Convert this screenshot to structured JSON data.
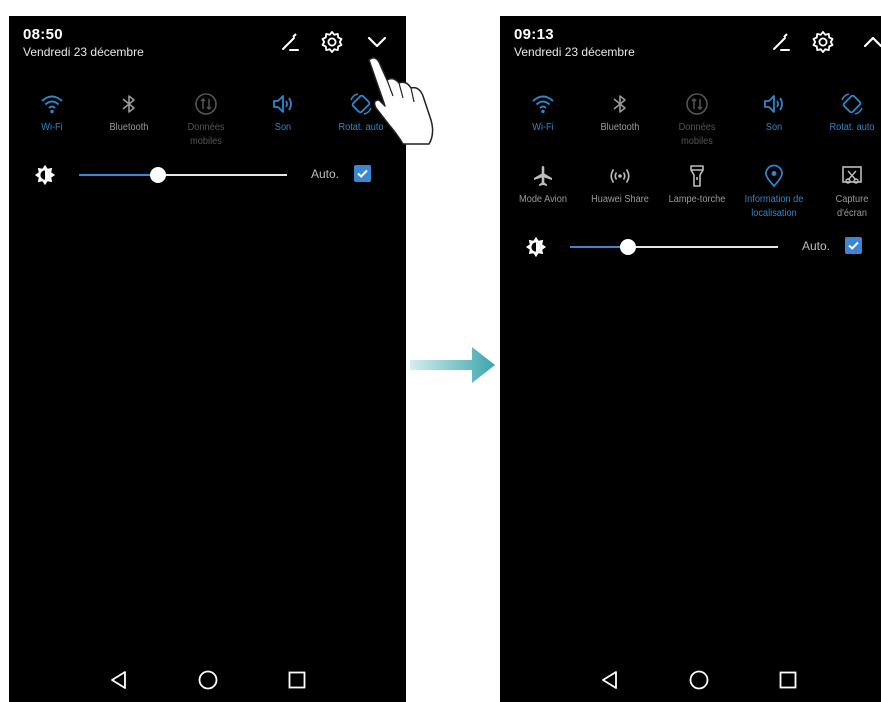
{
  "screen_left": {
    "time": "08:50",
    "date": "Vendredi 23 décembre",
    "header_icons": [
      "edit-icon",
      "settings-icon",
      "chevron-down-icon"
    ],
    "tiles": [
      {
        "label": "Wi-Fi",
        "icon": "wifi-icon",
        "state": "active"
      },
      {
        "label": "Bluetooth",
        "icon": "bluetooth-icon",
        "state": "inactive"
      },
      {
        "label": "Données\nmobiles",
        "icon": "mobile-data-icon",
        "state": "disabled"
      },
      {
        "label": "Son",
        "icon": "sound-icon",
        "state": "active"
      },
      {
        "label": "Rotat. auto",
        "icon": "auto-rotate-icon",
        "state": "active"
      }
    ],
    "brightness": {
      "level": 0.38,
      "auto_label": "Auto.",
      "auto_checked": true
    }
  },
  "screen_right": {
    "time": "09:13",
    "date": "Vendredi 23 décembre",
    "header_icons": [
      "edit-icon",
      "settings-icon",
      "chevron-up-icon"
    ],
    "tiles": [
      {
        "label": "Wi-Fi",
        "icon": "wifi-icon",
        "state": "active"
      },
      {
        "label": "Bluetooth",
        "icon": "bluetooth-icon",
        "state": "inactive"
      },
      {
        "label": "Données\nmobiles",
        "icon": "mobile-data-icon",
        "state": "disabled"
      },
      {
        "label": "Son",
        "icon": "sound-icon",
        "state": "active"
      },
      {
        "label": "Rotat. auto",
        "icon": "auto-rotate-icon",
        "state": "active"
      },
      {
        "label": "Mode Avion",
        "icon": "airplane-icon",
        "state": "inactive"
      },
      {
        "label": "Huawei Share",
        "icon": "huawei-share-icon",
        "state": "inactive"
      },
      {
        "label": "Lampe-torche",
        "icon": "flashlight-icon",
        "state": "inactive"
      },
      {
        "label": "Information de\nlocalisation",
        "icon": "location-icon",
        "state": "active"
      },
      {
        "label": "Capture\nd'écran",
        "icon": "screenshot-icon",
        "state": "inactive"
      }
    ],
    "brightness": {
      "level": 0.28,
      "auto_label": "Auto.",
      "auto_checked": true
    }
  },
  "navigation": [
    "back-icon",
    "home-icon",
    "recents-icon"
  ],
  "colors": {
    "background": "#000000",
    "accent": "#2f86c9",
    "slider_fill": "#3d86d3",
    "inactive_icon": "#9a9a9a",
    "disabled_icon": "#555555",
    "arrow_start": "#d6eeee",
    "arrow_end": "#3aa6ad"
  }
}
